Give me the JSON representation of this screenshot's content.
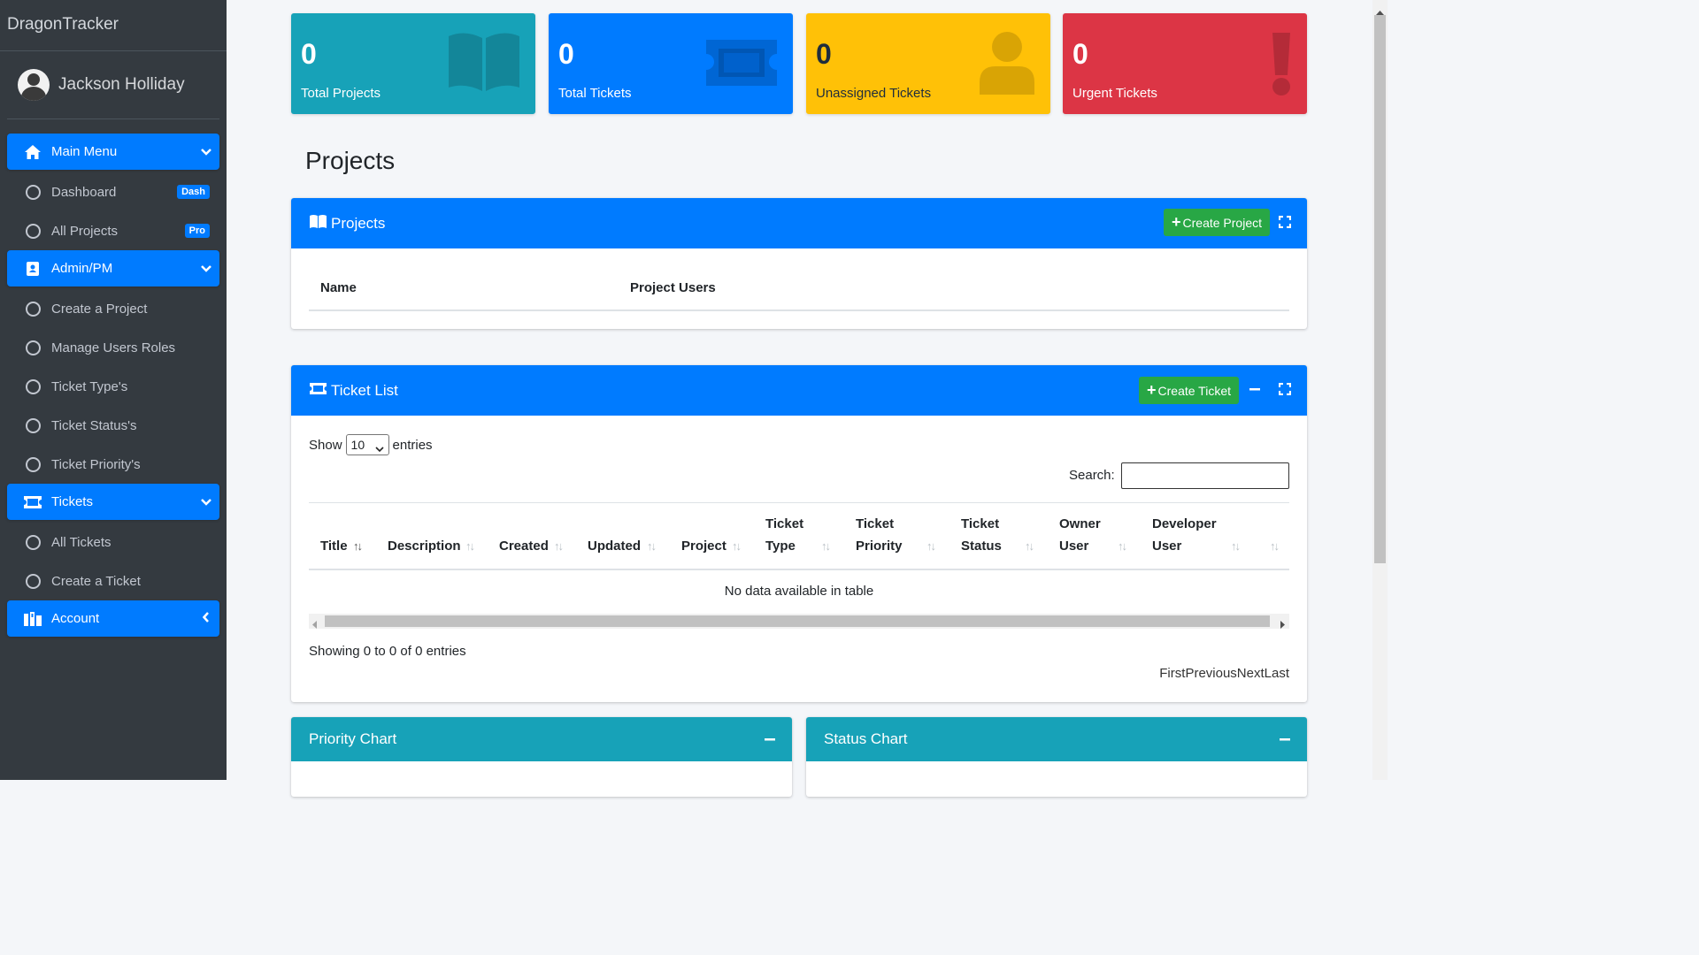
{
  "brand": "DragonTracker",
  "user": {
    "name": "Jackson Holliday"
  },
  "sidebar": {
    "main_menu": {
      "label": "Main Menu",
      "icon": "home-icon"
    },
    "main_items": [
      {
        "label": "Dashboard",
        "badge": "Dash"
      },
      {
        "label": "All Projects",
        "badge": "Pro"
      }
    ],
    "admin": {
      "label": "Admin/PM",
      "icon": "address-book-icon"
    },
    "admin_items": [
      {
        "label": "Create a Project"
      },
      {
        "label": "Manage Users Roles"
      },
      {
        "label": "Ticket Type's"
      },
      {
        "label": "Ticket Status's"
      },
      {
        "label": "Ticket Priority's"
      }
    ],
    "tickets": {
      "label": "Tickets",
      "icon": "ticket-icon"
    },
    "ticket_items": [
      {
        "label": "All Tickets"
      },
      {
        "label": "Create a Ticket"
      }
    ],
    "account": {
      "label": "Account",
      "icon": "users-icon"
    }
  },
  "stats": [
    {
      "value": "0",
      "label": "Total Projects",
      "icon": "book-icon",
      "color": "#17a2b8"
    },
    {
      "value": "0",
      "label": "Total Tickets",
      "icon": "ticket-icon",
      "color": "#007bff"
    },
    {
      "value": "0",
      "label": "Unassigned Tickets",
      "icon": "user-icon",
      "color": "#ffc107"
    },
    {
      "value": "0",
      "label": "Urgent Tickets",
      "icon": "exclamation-icon",
      "color": "#dc3545"
    }
  ],
  "page_title": "Projects",
  "projects_card": {
    "title": "Projects",
    "create_label": "Create Project",
    "columns": [
      "Name",
      "Project Users"
    ]
  },
  "tickets_card": {
    "title": "Ticket List",
    "create_label": "Create Ticket",
    "show_label": "Show",
    "entries_label": "entries",
    "page_size": "10",
    "search_label": "Search:",
    "columns": [
      {
        "line1": "Title",
        "line2": ""
      },
      {
        "line1": "Description",
        "line2": ""
      },
      {
        "line1": "Created",
        "line2": ""
      },
      {
        "line1": "Updated",
        "line2": ""
      },
      {
        "line1": "Project",
        "line2": ""
      },
      {
        "line1": "Ticket",
        "line2": "Type"
      },
      {
        "line1": "Ticket",
        "line2": "Priority"
      },
      {
        "line1": "Ticket",
        "line2": "Status"
      },
      {
        "line1": "Owner",
        "line2": "User"
      },
      {
        "line1": "Developer",
        "line2": "User"
      }
    ],
    "empty_text": "No data available in table",
    "info_text": "Showing 0 to 0 of 0 entries",
    "pagination": [
      "First",
      "Previous",
      "Next",
      "Last"
    ]
  },
  "charts": [
    {
      "title": "Priority Chart"
    },
    {
      "title": "Status Chart"
    }
  ],
  "colors": {
    "primary": "#007bff",
    "teal": "#17a2b8",
    "yellow": "#ffc107",
    "red": "#dc3545",
    "green": "#28a745",
    "sidebar": "#343a40"
  }
}
